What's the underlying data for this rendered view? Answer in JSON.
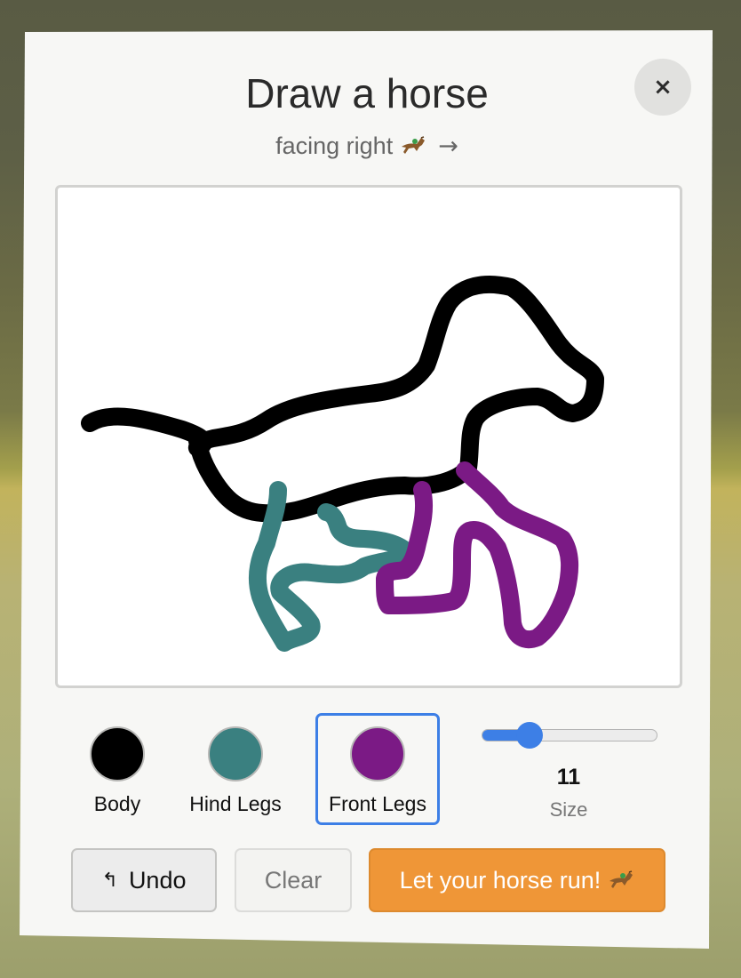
{
  "dialog": {
    "title": "Draw a horse",
    "subtitle": "facing right",
    "subtitle_emoji": "horse-racing-emoji",
    "subtitle_arrow": "→",
    "close_label": "×"
  },
  "palette": [
    {
      "label": "Body",
      "color": "#000000",
      "selected": false
    },
    {
      "label": "Hind Legs",
      "color": "#3a8080",
      "selected": false
    },
    {
      "label": "Front Legs",
      "color": "#7b1a85",
      "selected": true
    }
  ],
  "brush": {
    "size": 11,
    "size_label": "Size",
    "accent": "#3d7fe6"
  },
  "buttons": {
    "undo_icon": "↰",
    "undo": "Undo",
    "clear": "Clear",
    "run": "Let your horse run!",
    "run_emoji": "horse-racing-emoji",
    "run_color": "#ef9637"
  },
  "drawing": {
    "strokes": [
      {
        "part": "Body",
        "color": "#000000"
      },
      {
        "part": "Hind Legs",
        "color": "#3a8080"
      },
      {
        "part": "Front Legs",
        "color": "#7b1a85"
      }
    ]
  }
}
